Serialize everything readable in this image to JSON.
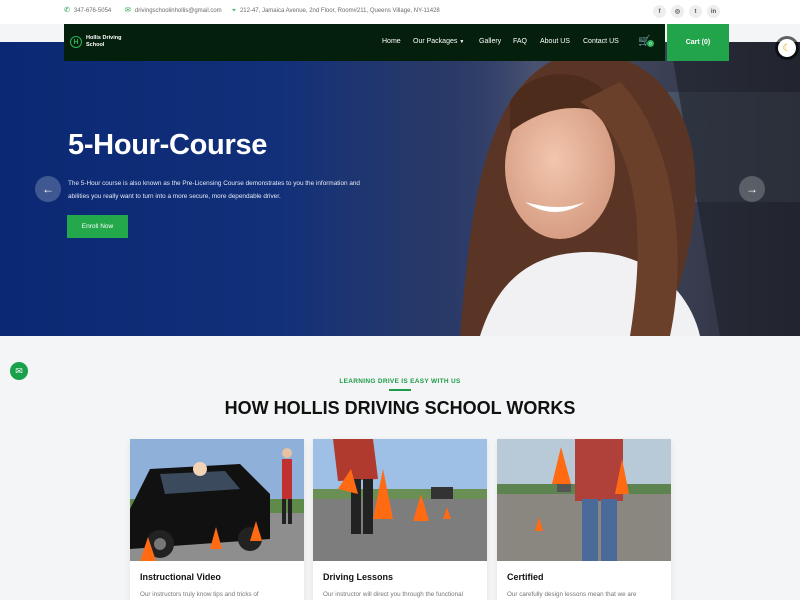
{
  "topbar": {
    "phone": "347-676-5054",
    "email": "drivingschoolinhollis@gmail.com",
    "address": "212-47, Jamaica Avenue, 2nd Floor, Room#211, Queens Village, NY-11428",
    "socials": [
      {
        "icon": "facebook-icon",
        "glyph": "f"
      },
      {
        "icon": "instagram-icon",
        "glyph": "◎"
      },
      {
        "icon": "twitter-icon",
        "glyph": "t"
      },
      {
        "icon": "linkedin-icon",
        "glyph": "in"
      }
    ]
  },
  "nav": {
    "logo_text": "Hollis Driving School",
    "items": [
      "Home",
      "Our Packages",
      "Gallery",
      "FAQ",
      "About US",
      "Contact US"
    ],
    "cart_count": "0",
    "cart_label": "Cart (0)"
  },
  "hero": {
    "title": "5-Hour-Course",
    "description": "The 5-Hour course is also known as the Pre-Licensing Course demonstrates to you the information and abilities you really want to turn into a more secure, more dependable driver.",
    "cta": "Enroll Now"
  },
  "works": {
    "eyebrow": "LEARNING DRIVE IS EASY WITH US",
    "title": "HOW HOLLIS DRIVING SCHOOL WORKS",
    "cards": [
      {
        "title": "Instructional Video",
        "text": "Our instructors truly know tips and tricks of"
      },
      {
        "title": "Driving Lessons",
        "text": "Our instructor will direct you through the functional"
      },
      {
        "title": "Certified",
        "text": "Our carefully design lessons mean that we are"
      }
    ]
  },
  "colors": {
    "accent": "#22a54a",
    "nav_bg": "#04200d",
    "hero_bg": "#0a2873"
  }
}
